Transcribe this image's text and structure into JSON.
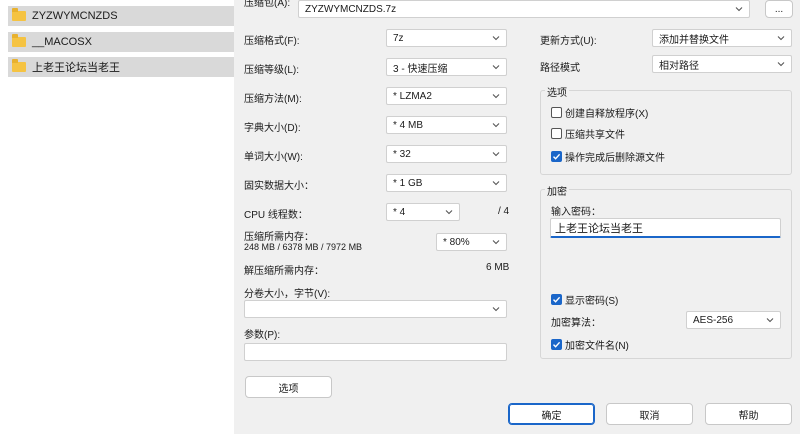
{
  "file_list": {
    "items": [
      {
        "name": "ZYZWYMCNZDS"
      },
      {
        "name": "__MACOSX"
      },
      {
        "name": "上老王论坛当老王"
      }
    ]
  },
  "archive": {
    "label_partial": "压缩包(A):",
    "value": "ZYZWYMCNZDS.7z",
    "browse_label": "..."
  },
  "left": {
    "format_label": "压缩格式(F):",
    "format_value": "7z",
    "level_label": "压缩等级(L):",
    "level_value": "3 - 快速压缩",
    "method_label": "压缩方法(M):",
    "method_value": "* LZMA2",
    "dict_label": "字典大小(D):",
    "dict_value": "* 4 MB",
    "word_label": "单词大小(W):",
    "word_value": "* 32",
    "solid_label": "固实数据大小：",
    "solid_value": "* 1 GB",
    "threads_label": "CPU 线程数：",
    "threads_value": "* 4",
    "threads_max": "/ 4",
    "mem_label": "压缩所需内存：",
    "mem_detail": "248 MB / 6378 MB / 7972 MB",
    "mem_value": "* 80%",
    "decomp_label": "解压缩所需内存：",
    "decomp_value": "6 MB",
    "split_label": "分卷大小，字节(V):",
    "split_value": "",
    "params_label": "参数(P):",
    "params_value": "",
    "options_button": "选项"
  },
  "right": {
    "update_label": "更新方式(U):",
    "update_value": "添加并替换文件",
    "path_label": "路径模式",
    "path_value": "相对路径",
    "options_group": "选项",
    "opt_sfx": "创建自释放程序(X)",
    "opt_shared": "压缩共享文件",
    "opt_delete": "操作完成后删除源文件",
    "enc_group": "加密",
    "pwd_label": "输入密码：",
    "pwd_value": "上老王论坛当老王",
    "show_pwd": "显示密码(S)",
    "enc_method_label": "加密算法：",
    "enc_method_value": "AES-256",
    "enc_names": "加密文件名(N)"
  },
  "buttons": {
    "ok": "确定",
    "cancel": "取消",
    "help": "帮助"
  },
  "checks": {
    "sfx": false,
    "shared": false,
    "delete": true,
    "show_pwd": true,
    "enc_names": true
  },
  "colors": {
    "accent": "#1a66c9",
    "folder": "#f5c342"
  }
}
